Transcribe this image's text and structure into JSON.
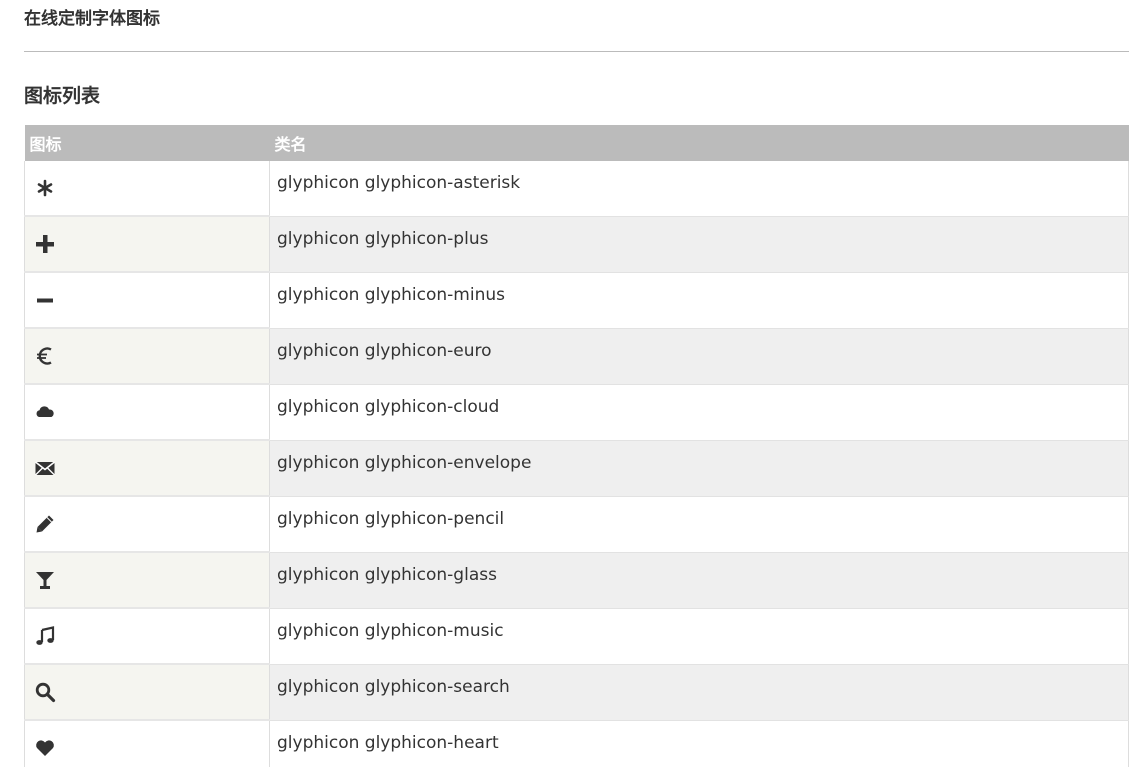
{
  "page": {
    "title": "在线定制字体图标",
    "section_title": "图标列表"
  },
  "table": {
    "headers": {
      "icon": "图标",
      "class_name": "类名"
    },
    "rows": [
      {
        "icon": "asterisk-icon",
        "class_name": "glyphicon glyphicon-asterisk"
      },
      {
        "icon": "plus-icon",
        "class_name": "glyphicon glyphicon-plus"
      },
      {
        "icon": "minus-icon",
        "class_name": "glyphicon glyphicon-minus"
      },
      {
        "icon": "euro-icon",
        "class_name": "glyphicon glyphicon-euro"
      },
      {
        "icon": "cloud-icon",
        "class_name": "glyphicon glyphicon-cloud"
      },
      {
        "icon": "envelope-icon",
        "class_name": "glyphicon glyphicon-envelope"
      },
      {
        "icon": "pencil-icon",
        "class_name": "glyphicon glyphicon-pencil"
      },
      {
        "icon": "glass-icon",
        "class_name": "glyphicon glyphicon-glass"
      },
      {
        "icon": "music-icon",
        "class_name": "glyphicon glyphicon-music"
      },
      {
        "icon": "search-icon",
        "class_name": "glyphicon glyphicon-search"
      },
      {
        "icon": "heart-icon",
        "class_name": "glyphicon glyphicon-heart"
      }
    ]
  },
  "colors": {
    "header_bg": "#bbbbbb",
    "header_text": "#ffffff",
    "row_alt_bg": "#efefef",
    "icon_color": "#333333"
  }
}
